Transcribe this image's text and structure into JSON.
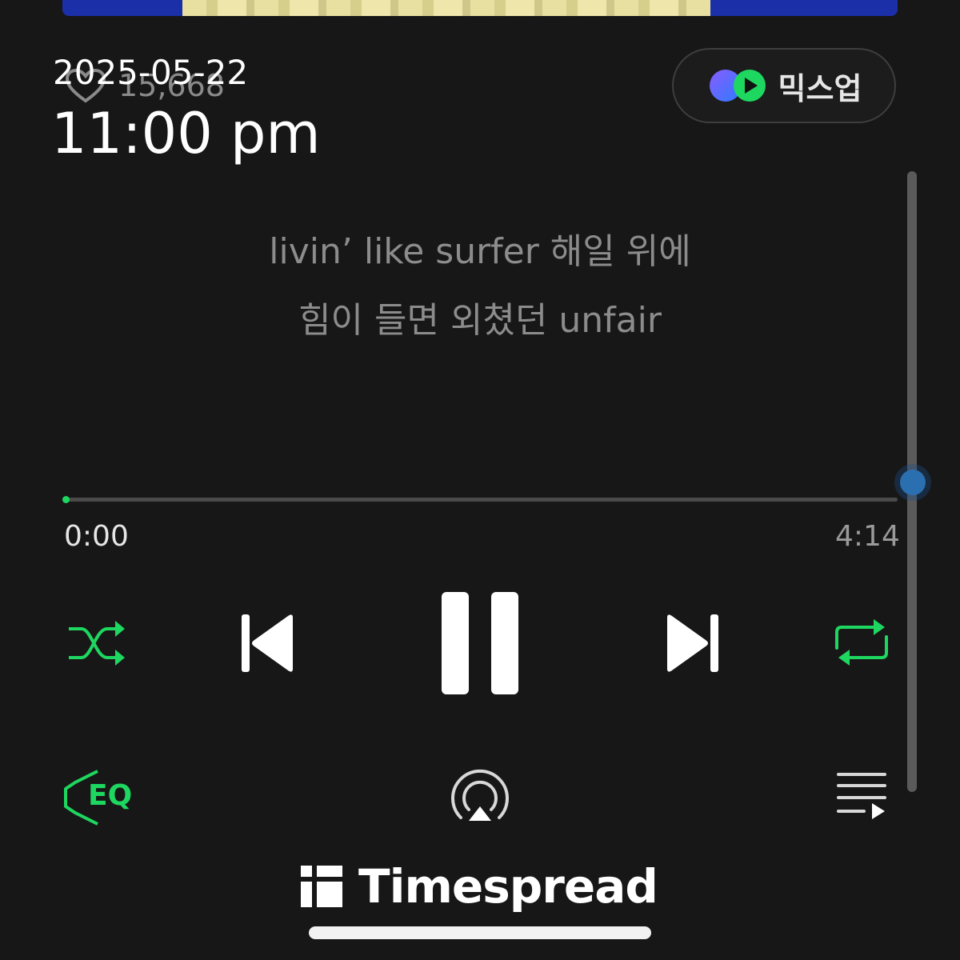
{
  "overlay": {
    "date": "2025-05-22",
    "time": "11:00 pm"
  },
  "like": {
    "count": "15,668"
  },
  "mixup": {
    "label": "믹스업"
  },
  "lyrics": [
    "livin’ like surfer 해일 위에",
    "힘이 들면 외쳤던 unfair"
  ],
  "playback": {
    "elapsed": "0:00",
    "total": "4:14",
    "progress": 0
  },
  "controls": {
    "shuffle_icon": "shuffle-icon",
    "previous_icon": "skip-previous-icon",
    "pause_icon": "pause-icon",
    "next_icon": "skip-next-icon",
    "repeat_icon": "repeat-icon",
    "eq_label": "EQ",
    "airplay_icon": "airplay-icon",
    "playlist_icon": "playlist-icon"
  },
  "watermark": {
    "text": "Timespread"
  },
  "colors": {
    "accent": "#1ed760",
    "background": "#171717",
    "lyric_text": "#8c8c8c"
  }
}
